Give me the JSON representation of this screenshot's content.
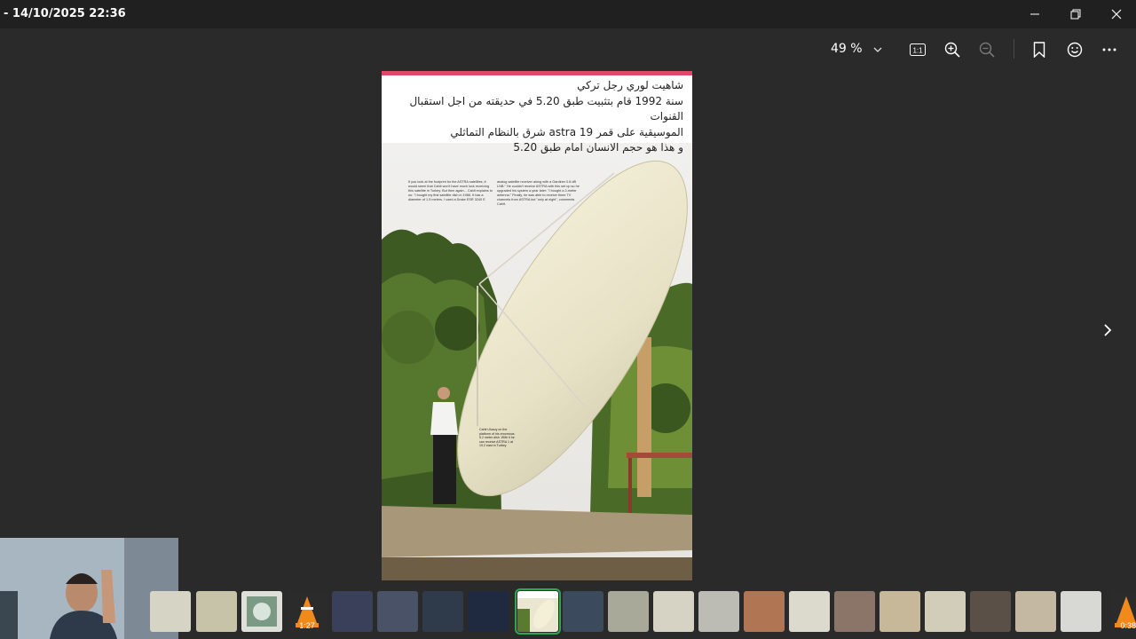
{
  "window": {
    "title": "- 14/10/2025 22:36"
  },
  "toolbar": {
    "zoom_value": "49 %"
  },
  "photo": {
    "caption": [
      "شاهيت لوري رجل تركي",
      "سنة 1992 قام بتثبيت طبق 5.20 في حديقته من اجل استقبال القنوات",
      "الموسيقية على قمر astra 19 شرق بالنظام التماثلي",
      "و هذا هو حجم الانسان امام طبق 5.20"
    ],
    "article_col1": "If you look at the footprint for the ASTRA satellites, it would seem that Cahit won't have much luck receiving this satellite in Turkey. But then again... Cahit explains to us: \"I bought my first satellite dish in 1986. It has a diameter of 1.5 meters. I used a Drake ESR 3240 E",
    "article_col2": "analog satellite receiver along with a Gardiner 0.8 dB LNB.\" He couldn't receive ASTRA with this set up so he upgraded his system a year later: \"I bought a 2-meter antenna.\" Finally, he was able to receive three TV channels from ASTRA but \"only at night\", comments Cahit.",
    "inset_caption": "Cahit Ulusoy on the platform of his enormous 5.2 meter dish. With it he can receive ASTRA 1 at 19.2 east in Turkey"
  },
  "filmstrip": {
    "durations": {
      "video_1": "1:27",
      "video_2": "0:38"
    }
  }
}
